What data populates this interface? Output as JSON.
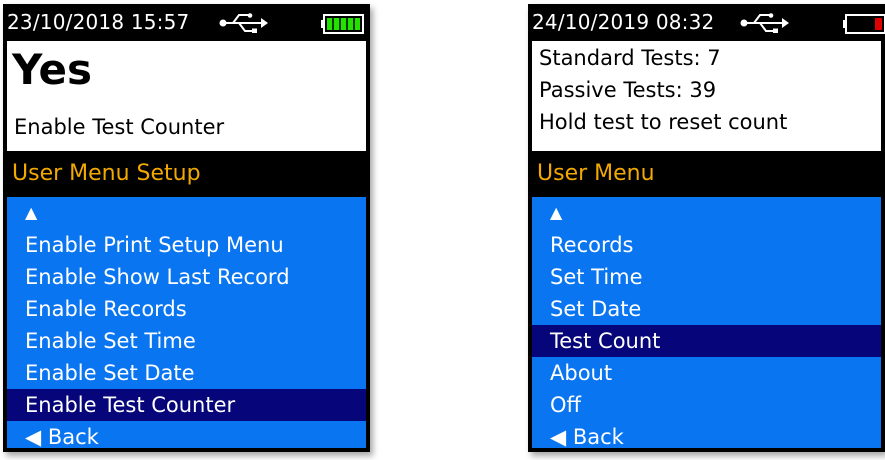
{
  "left_screen": {
    "status": {
      "datetime": "23/10/2018  15:57"
    },
    "info": {
      "value": "Yes",
      "label": "Enable Test Counter"
    },
    "menu_title": "User Menu Setup",
    "menu": {
      "up": "▲",
      "items": [
        "Enable Print Setup Menu",
        "Enable Show Last Record",
        "Enable Records",
        "Enable Set Time",
        "Enable Set Date",
        "Enable Test Counter"
      ],
      "back": "◀ Back"
    },
    "battery_color": "#22e000"
  },
  "right_screen": {
    "status": {
      "datetime": "24/10/2019  08:32"
    },
    "info": {
      "lines": [
        "Standard Tests: 7",
        "Passive Tests: 39",
        "Hold test to reset count"
      ]
    },
    "menu_title": "User Menu",
    "menu": {
      "up": "▲",
      "items": [
        "Records",
        "Set Time",
        "Set Date",
        "Test Count",
        "About",
        "Off"
      ],
      "back": "◀ Back"
    },
    "battery_color": "#e00000"
  },
  "colors": {
    "menu_background": "#0a75f0",
    "selected_background": "#06067a",
    "menu_title_text": "#f2a900"
  }
}
